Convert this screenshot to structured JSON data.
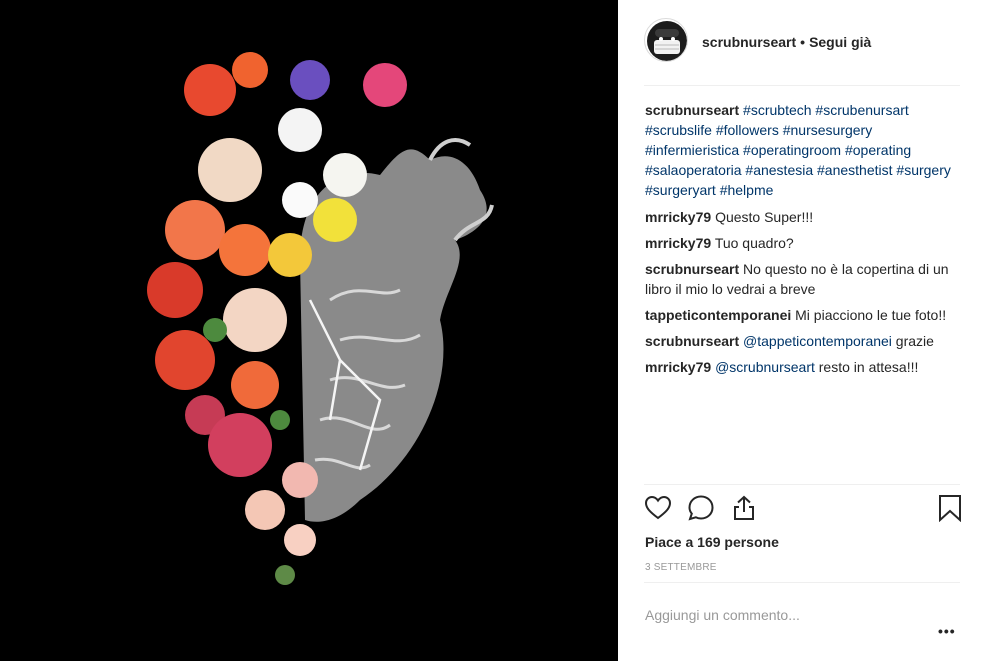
{
  "post": {
    "image_alt": "Anatomical heart with flowers"
  },
  "header": {
    "username": "scrubnurseart",
    "separator": "•",
    "follow_status": "Segui già"
  },
  "caption": {
    "username": "scrubnurseart",
    "hashtags": [
      "#scrubtech",
      "#scrubenursart",
      "#scrubslife",
      "#followers",
      "#nursesurgery",
      "#infermieristica",
      "#operatingroom",
      "#operating",
      "#salaoperatoria",
      "#anestesia",
      "#anesthetist",
      "#surgery",
      "#surgeryart",
      "#helpme"
    ]
  },
  "comments": [
    {
      "username": "mrricky79",
      "text": "Questo Super!!!"
    },
    {
      "username": "mrricky79",
      "text": "Tuo quadro?"
    },
    {
      "username": "scrubnurseart",
      "text": "No questo no è la copertina di un libro il mio lo vedrai a breve"
    },
    {
      "username": "tappeticontemporanei",
      "text": "Mi piacciono le tue foto!!"
    },
    {
      "username": "scrubnurseart",
      "mention": "@tappeticontemporanei",
      "text": "grazie"
    },
    {
      "username": "mrricky79",
      "mention": "@scrubnurseart",
      "text": "resto in attesa!!!"
    }
  ],
  "actions": {
    "icons": [
      "heart-icon",
      "comment-icon",
      "share-icon",
      "bookmark-icon"
    ],
    "likes_text": "Piace a 169 persone",
    "date": "3 SETTEMBRE"
  },
  "add_comment": {
    "placeholder": "Aggiungi un commento...",
    "more_label": "•••"
  },
  "colors": {
    "text": "#262626",
    "hashtag": "#003569",
    "muted": "#999999",
    "divider": "#efefef",
    "media_bg": "#000000"
  }
}
